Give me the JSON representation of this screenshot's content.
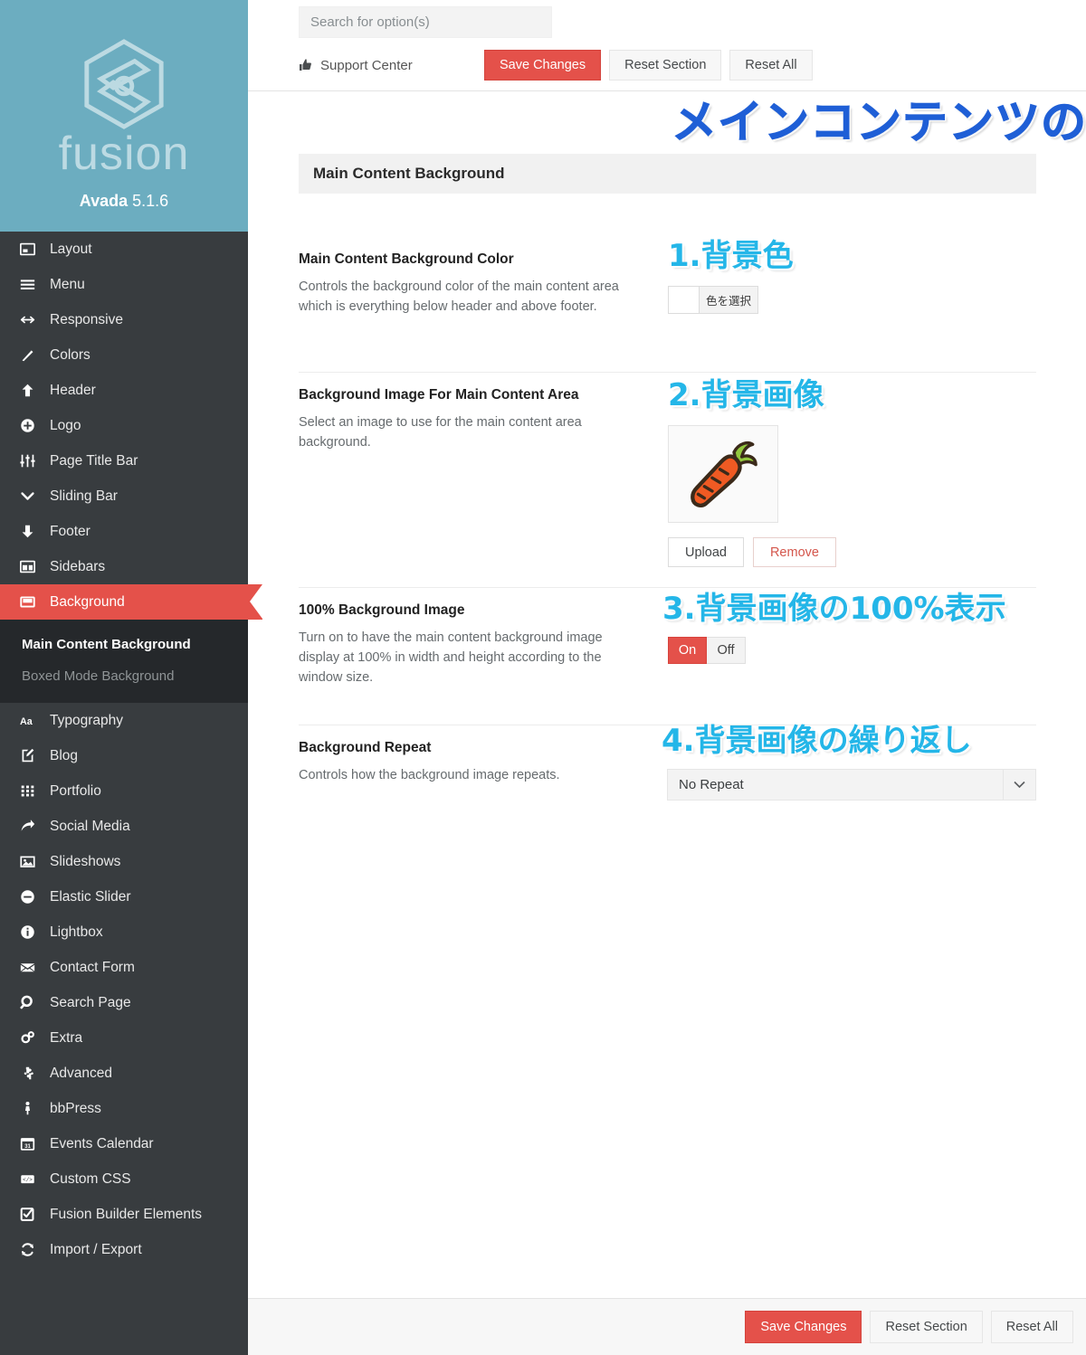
{
  "brand": {
    "logo_icon": "fusion-hexagon-logo",
    "wordmark": "fusion",
    "product": "Avada",
    "version": "5.1.6"
  },
  "sidebar": {
    "items": [
      {
        "label": "Layout",
        "icon": "layout-icon",
        "active": false
      },
      {
        "label": "Menu",
        "icon": "hamburger-menu-icon",
        "active": false
      },
      {
        "label": "Responsive",
        "icon": "arrows-horizontal-icon",
        "active": false
      },
      {
        "label": "Colors",
        "icon": "paintbrush-icon",
        "active": false
      },
      {
        "label": "Header",
        "icon": "arrow-up-icon",
        "active": false
      },
      {
        "label": "Logo",
        "icon": "plus-circle-icon",
        "active": false
      },
      {
        "label": "Page Title Bar",
        "icon": "sliders-icon",
        "active": false
      },
      {
        "label": "Sliding Bar",
        "icon": "chevron-down-icon",
        "active": false
      },
      {
        "label": "Footer",
        "icon": "arrow-down-icon",
        "active": false
      },
      {
        "label": "Sidebars",
        "icon": "sidebars-icon",
        "active": false
      },
      {
        "label": "Background",
        "icon": "window-icon",
        "active": true
      }
    ],
    "submenu": [
      {
        "label": "Main Content Background",
        "current": true
      },
      {
        "label": "Boxed Mode Background",
        "current": false
      }
    ],
    "items_after": [
      {
        "label": "Typography",
        "icon": "typography-aa-icon"
      },
      {
        "label": "Blog",
        "icon": "pencil-document-icon"
      },
      {
        "label": "Portfolio",
        "icon": "grid-dots-icon"
      },
      {
        "label": "Social Media",
        "icon": "share-arrow-icon"
      },
      {
        "label": "Slideshows",
        "icon": "image-icon"
      },
      {
        "label": "Elastic Slider",
        "icon": "minus-circle-icon"
      },
      {
        "label": "Lightbox",
        "icon": "info-circle-icon"
      },
      {
        "label": "Contact Form",
        "icon": "envelope-icon"
      },
      {
        "label": "Search Page",
        "icon": "magnifier-icon"
      },
      {
        "label": "Extra",
        "icon": "gears-icon"
      },
      {
        "label": "Advanced",
        "icon": "puzzle-piece-icon"
      },
      {
        "label": "bbPress",
        "icon": "person-icon"
      },
      {
        "label": "Events Calendar",
        "icon": "calendar-icon"
      },
      {
        "label": "Custom CSS",
        "icon": "code-window-icon"
      },
      {
        "label": "Fusion Builder Elements",
        "icon": "checkbox-icon"
      },
      {
        "label": "Import / Export",
        "icon": "refresh-cycle-icon"
      }
    ]
  },
  "topbar": {
    "search_placeholder": "Search for option(s)",
    "search_value": "",
    "support_center": "Support Center",
    "support_icon": "thumbs-up-icon",
    "save": "Save Changes",
    "reset_section": "Reset Section",
    "reset_all": "Reset All"
  },
  "annotations": {
    "page_title_jp": "メインコンテンツの背景",
    "note1": "1.背景色",
    "note2": "2.背景画像",
    "note3": "3.背景画像の100%表示",
    "note4": "4.背景画像の繰り返し"
  },
  "section": {
    "header": "Main Content Background"
  },
  "options": [
    {
      "title": "Main Content Background Color",
      "desc": "Controls the background color of the main content area which is everything below header and above footer.",
      "control": "color",
      "color_value": "#ffffff",
      "pick_label": "色を選択"
    },
    {
      "title": "Background Image For Main Content Area",
      "desc": "Select an image to use for the main content area background.",
      "control": "image",
      "image_icon": "carrot-image",
      "upload_label": "Upload",
      "remove_label": "Remove"
    },
    {
      "title": "100% Background Image",
      "desc": "Turn on to have the main content background image display at 100% in width and height according to the window size.",
      "control": "toggle",
      "on_label": "On",
      "off_label": "Off",
      "selected": "On"
    },
    {
      "title": "Background Repeat",
      "desc": "Controls how the background image repeats.",
      "control": "select",
      "selected": "No Repeat",
      "chevron_icon": "chevron-down-icon"
    }
  ],
  "footer": {
    "save": "Save Changes",
    "reset_section": "Reset Section",
    "reset_all": "Reset All"
  },
  "colors": {
    "brand_teal": "#6cadc0",
    "sidebar_dark": "#383c3f",
    "submenu_dark": "#25282b",
    "accent_red": "#e4514a",
    "note_cyan": "#24b6e8",
    "title_blue": "#1f5fd6"
  }
}
